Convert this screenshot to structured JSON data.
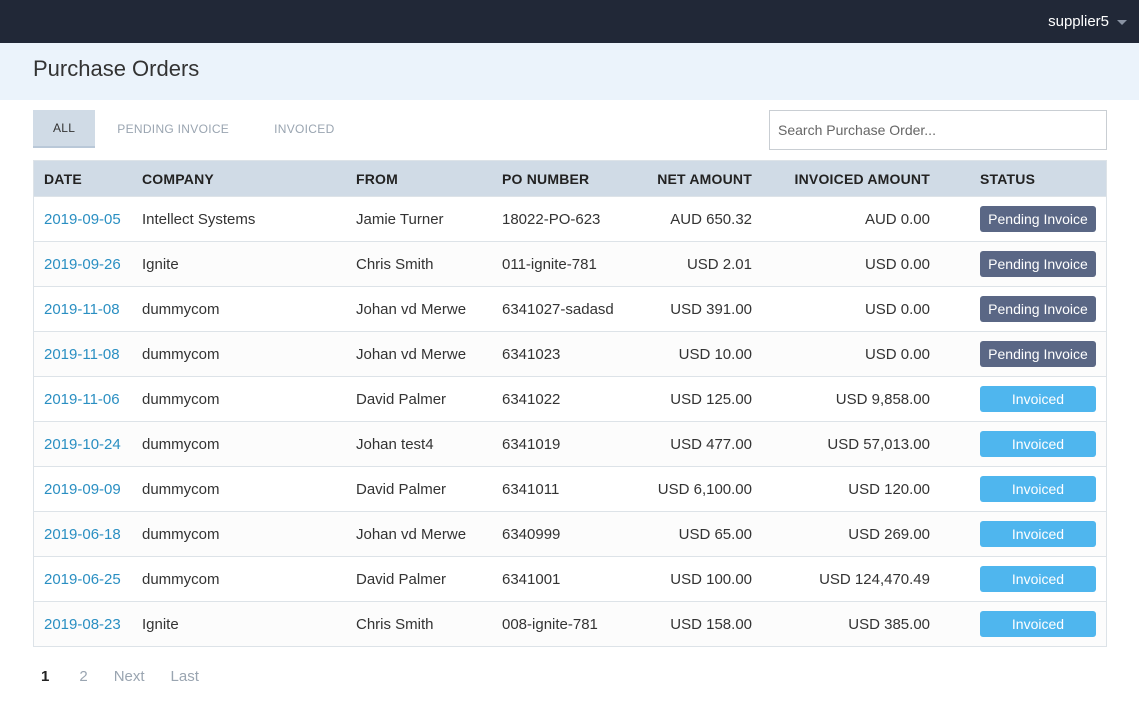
{
  "header": {
    "user": "supplier5"
  },
  "page": {
    "title": "Purchase Orders"
  },
  "tabs": [
    {
      "label": "ALL",
      "active": true
    },
    {
      "label": "PENDING INVOICE",
      "active": false
    },
    {
      "label": "INVOICED",
      "active": false
    }
  ],
  "search": {
    "placeholder": "Search Purchase Order...",
    "value": ""
  },
  "table": {
    "headers": [
      "DATE",
      "COMPANY",
      "FROM",
      "PO NUMBER",
      "NET AMOUNT",
      "INVOICED AMOUNT",
      "STATUS"
    ],
    "rows": [
      {
        "date": "2019-09-05",
        "company": "Intellect Systems",
        "from": "Jamie Turner",
        "po": "18022-PO-623",
        "net": "AUD 650.32",
        "invoiced": "AUD 0.00",
        "status": "Pending Invoice"
      },
      {
        "date": "2019-09-26",
        "company": "Ignite",
        "from": "Chris Smith",
        "po": "011-ignite-781",
        "net": "USD 2.01",
        "invoiced": "USD 0.00",
        "status": "Pending Invoice"
      },
      {
        "date": "2019-11-08",
        "company": "dummycom",
        "from": "Johan vd Merwe",
        "po": "6341027-sadasd",
        "net": "USD 391.00",
        "invoiced": "USD 0.00",
        "status": "Pending Invoice"
      },
      {
        "date": "2019-11-08",
        "company": "dummycom",
        "from": "Johan vd Merwe",
        "po": "6341023",
        "net": "USD 10.00",
        "invoiced": "USD 0.00",
        "status": "Pending Invoice"
      },
      {
        "date": "2019-11-06",
        "company": "dummycom",
        "from": "David Palmer",
        "po": "6341022",
        "net": "USD 125.00",
        "invoiced": "USD 9,858.00",
        "status": "Invoiced"
      },
      {
        "date": "2019-10-24",
        "company": "dummycom",
        "from": "Johan test4",
        "po": "6341019",
        "net": "USD 477.00",
        "invoiced": "USD 57,013.00",
        "status": "Invoiced"
      },
      {
        "date": "2019-09-09",
        "company": "dummycom",
        "from": "David Palmer",
        "po": "6341011",
        "net": "USD 6,100.00",
        "invoiced": "USD 120.00",
        "status": "Invoiced"
      },
      {
        "date": "2019-06-18",
        "company": "dummycom",
        "from": "Johan vd Merwe",
        "po": "6340999",
        "net": "USD 65.00",
        "invoiced": "USD 269.00",
        "status": "Invoiced"
      },
      {
        "date": "2019-06-25",
        "company": "dummycom",
        "from": "David Palmer",
        "po": "6341001",
        "net": "USD 100.00",
        "invoiced": "USD 124,470.49",
        "status": "Invoiced"
      },
      {
        "date": "2019-08-23",
        "company": "Ignite",
        "from": "Chris Smith",
        "po": "008-ignite-781",
        "net": "USD 158.00",
        "invoiced": "USD 385.00",
        "status": "Invoiced"
      }
    ]
  },
  "pagination": {
    "pages": [
      "1",
      "2"
    ],
    "current": "1",
    "next_label": "Next",
    "last_label": "Last"
  },
  "colors": {
    "topbar": "#212837",
    "accent_link": "#2a8fc2",
    "pending_badge": "#5a6785",
    "invoiced_badge": "#4fb6ee"
  },
  "icons": {
    "user_menu": "chevron-down-icon"
  }
}
